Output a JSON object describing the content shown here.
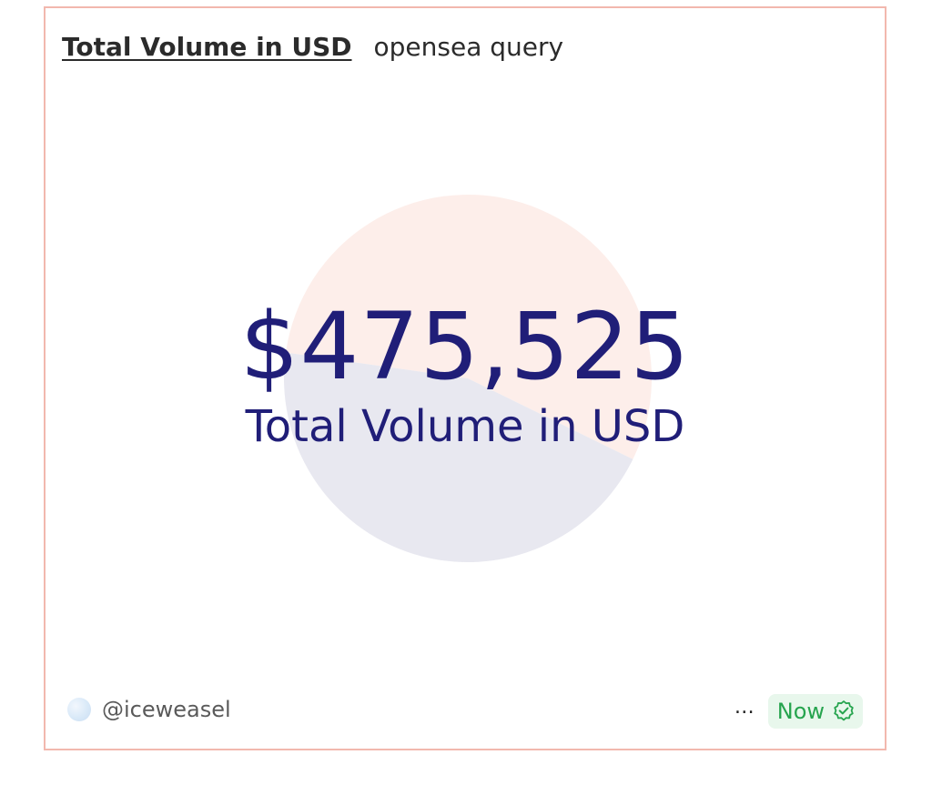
{
  "header": {
    "title": "Total Volume in USD",
    "query_name": "opensea query"
  },
  "counter": {
    "value": "$475,525",
    "label": "Total Volume in USD"
  },
  "background_pie": {
    "slices": [
      {
        "fraction": 0.55,
        "color": "#fdeeea"
      },
      {
        "fraction": 0.45,
        "color": "#e8e8f0"
      }
    ]
  },
  "footer": {
    "avatar_icon": "avatar",
    "username": "@iceweasel",
    "more_icon": "…",
    "status": "Now",
    "status_icon": "verified-check-icon"
  },
  "colors": {
    "border": "#f2b8ae",
    "counter_text": "#201e78",
    "status_green": "#26a44e",
    "status_bg": "#e8f7ec"
  }
}
